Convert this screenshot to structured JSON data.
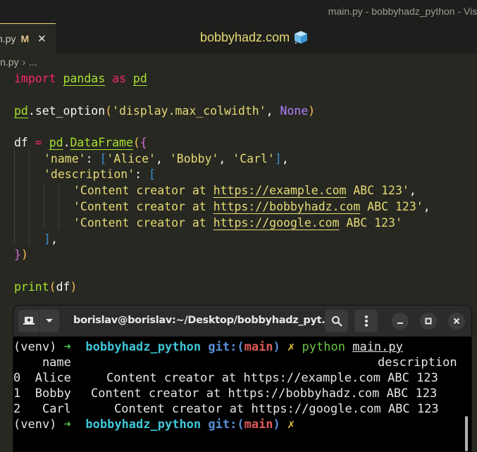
{
  "window": {
    "title": "main.py - bobbyhadz_python - Visu"
  },
  "tabs": [
    {
      "label": "n.py",
      "modified_badge": "M",
      "close_icon": "close-icon"
    }
  ],
  "banner": {
    "text": "bobbyhadz.com",
    "icon": "cube-icon"
  },
  "breadcrumb": {
    "file": "in.py",
    "separator": "›",
    "more": "..."
  },
  "editor": {
    "lines": {
      "l1": {
        "import": "import",
        "module": "pandas",
        "as": "as",
        "alias": "pd"
      },
      "l3": {
        "obj": "pd",
        "dot": ".",
        "method": "set_option",
        "open": "(",
        "arg": "'display.max_colwidth'",
        "comma": ", ",
        "none": "None",
        "close": ")"
      },
      "l5": {
        "var": "df",
        "eq": " = ",
        "obj": "pd",
        "dot": ".",
        "cls": "DataFrame",
        "open": "(",
        "brace": "{"
      },
      "l6": {
        "key": "'name'",
        "colon": ": ",
        "open": "[",
        "v1": "'Alice'",
        "c1": ", ",
        "v2": "'Bobby'",
        "c2": ", ",
        "v3": "'Carl'",
        "close": "]",
        "comma": ","
      },
      "l7": {
        "key": "'description'",
        "colon": ": ",
        "open": "["
      },
      "l8": {
        "pre": "'Content creator at ",
        "url": "https://example.com",
        "post": " ABC 123'",
        "comma": ","
      },
      "l9": {
        "pre": "'Content creator at ",
        "url": "https://bobbyhadz.com",
        "post": " ABC 123'",
        "comma": ","
      },
      "l10": {
        "pre": "'Content creator at ",
        "url": "https://google.com",
        "post": " ABC 123'"
      },
      "l11": {
        "close": "]",
        "comma": ","
      },
      "l12": {
        "brace": "}",
        "paren": ")"
      },
      "l14": {
        "fn": "print",
        "open": "(",
        "arg": "df",
        "close": ")"
      }
    }
  },
  "terminal": {
    "title": "borislav@borislav:~/Desktop/bobbyhadz_pyt...",
    "buttons": {
      "new_tab": "new-tab-icon",
      "dropdown": "chevron-down-icon",
      "search": "search-icon",
      "menu": "kebab-menu-icon",
      "minimize": "minimize-icon",
      "maximize": "maximize-icon",
      "close": "close-icon"
    },
    "prompt": {
      "venv": "(venv) ",
      "arrow": "➜",
      "dir": "bobbyhadz_python",
      "git_label": "git:(",
      "branch": "main",
      "git_close": ")",
      "dirty": "✗"
    },
    "command": {
      "program": "python",
      "file": "main.py"
    },
    "output": {
      "header_name": "    name",
      "header_desc": "description",
      "rows": [
        {
          "index": "0",
          "name": "Alice",
          "description": "Content creator at https://example.com ABC 123"
        },
        {
          "index": "1",
          "name": "Bobby",
          "description": "Content creator at https://bobbyhadz.com ABC 123"
        },
        {
          "index": "2",
          "name": "Carl",
          "description": "Content creator at https://google.com ABC 123"
        }
      ]
    }
  }
}
